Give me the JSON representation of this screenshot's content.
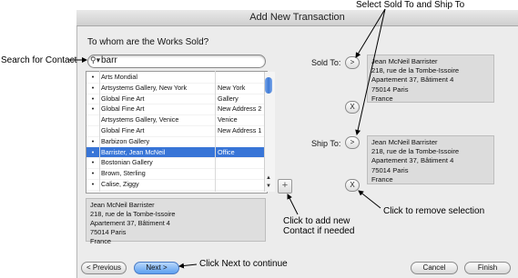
{
  "window": {
    "title": "Add New Transaction"
  },
  "question": "To whom are the Works Sold?",
  "search": {
    "value": "barr"
  },
  "contacts": [
    {
      "bullet": "•",
      "name": "Arts Mondial",
      "address": "",
      "selected": false
    },
    {
      "bullet": "•",
      "name": "Artsystems Gallery, New York",
      "address": "New York",
      "selected": false
    },
    {
      "bullet": "•",
      "name": "Global Fine Art",
      "address": "Gallery",
      "selected": false
    },
    {
      "bullet": "•",
      "name": "Global Fine Art",
      "address": "New Address 2",
      "selected": false
    },
    {
      "bullet": "",
      "name": "Artsystems Gallery, Venice",
      "address": "Venice",
      "selected": false
    },
    {
      "bullet": "",
      "name": "Global Fine Art",
      "address": "New Address 1",
      "selected": false
    },
    {
      "bullet": "•",
      "name": "Barbizon Gallery",
      "address": "",
      "selected": false
    },
    {
      "bullet": "•",
      "name": "Barrister, Jean McNeil",
      "address": "Office",
      "selected": true
    },
    {
      "bullet": "•",
      "name": "Bostonian Gallery",
      "address": "",
      "selected": false
    },
    {
      "bullet": "•",
      "name": "Brown, Sterling",
      "address": "",
      "selected": false
    },
    {
      "bullet": "•",
      "name": "Calise, Ziggy",
      "address": "",
      "selected": false
    }
  ],
  "selected_address": {
    "line1": "Jean McNeil Barrister",
    "line2": "218, rue de la Tombe-Issoire",
    "line3": "Apartement 37, Bâtiment 4",
    "line4": "75014 Paris",
    "line5": "France"
  },
  "sold_to": {
    "label": "Sold To:",
    "line1": "Jean McNeil Barrister",
    "line2": "218, rue de la Tombe-Issoire",
    "line3": "Apartement 37, Bâtiment 4",
    "line4": "75014 Paris",
    "line5": "France"
  },
  "ship_to": {
    "label": "Ship To:",
    "line1": "Jean McNeil Barrister",
    "line2": "218, rue de la Tombe-Issoire",
    "line3": "Apartement 37, Bâtiment 4",
    "line4": "75014 Paris",
    "line5": "France"
  },
  "buttons": {
    "select": ">",
    "remove": "X",
    "add": "+",
    "previous": "< Previous",
    "next": "Next >",
    "cancel": "Cancel",
    "finish": "Finish"
  },
  "annotations": {
    "select_sold_ship": "Select Sold To and Ship To",
    "search_contact": "Search for Contact",
    "add_contact_line1": "Click to add new",
    "add_contact_line2": "Contact if needed",
    "remove_selection": "Click to remove selection",
    "next_continue": "Click Next to continue"
  }
}
